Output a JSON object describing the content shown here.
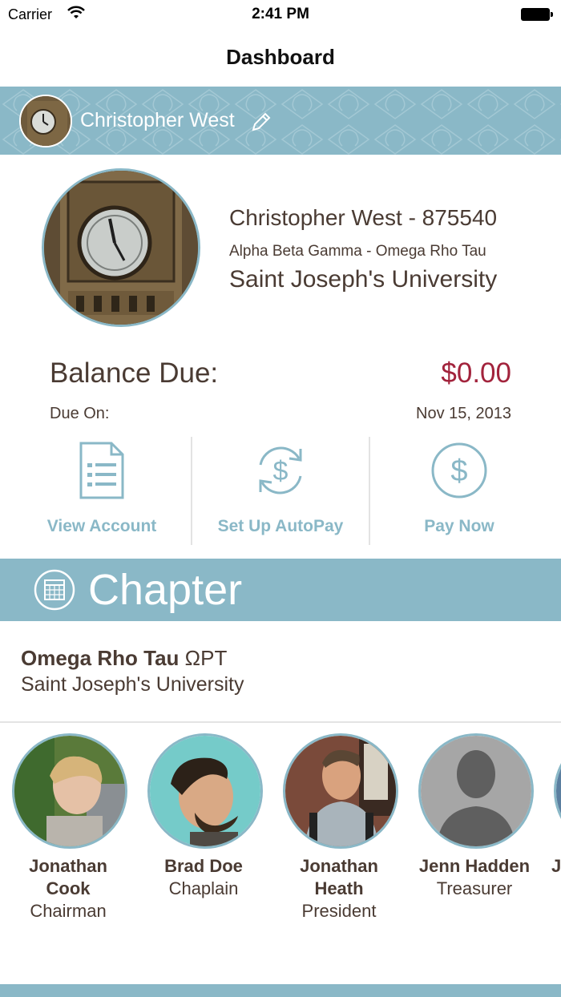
{
  "status": {
    "carrier": "Carrier",
    "time": "2:41 PM"
  },
  "nav": {
    "title": "Dashboard"
  },
  "strip": {
    "name": "Christopher West"
  },
  "profile": {
    "name_id": "Christopher West - 875540",
    "organization": "Alpha Beta Gamma - Omega Rho Tau",
    "school": "Saint Joseph's University"
  },
  "balance": {
    "label": "Balance Due:",
    "amount": "$0.00",
    "due_label": "Due On:",
    "due_date": "Nov 15, 2013"
  },
  "actions": [
    {
      "label": "View Account",
      "icon": "document-list-icon"
    },
    {
      "label": "Set Up AutoPay",
      "icon": "autopay-cycle-icon"
    },
    {
      "label": "Pay Now",
      "icon": "dollar-circle-icon"
    }
  ],
  "chapter": {
    "title": "Chapter",
    "name": "Omega Rho Tau",
    "letters": "ΩPT",
    "school": "Saint Joseph's University"
  },
  "officers": [
    {
      "name_line1": "Jonathan",
      "name_line2": "Cook",
      "role": "Chairman"
    },
    {
      "name_line1": "Brad Doe",
      "name_line2": "",
      "role": "Chaplain"
    },
    {
      "name_line1": "Jonathan",
      "name_line2": "Heath",
      "role": "President"
    },
    {
      "name_line1": "Jenn Hadden",
      "name_line2": "",
      "role": "Treasurer"
    },
    {
      "name_line1": "J",
      "name_line2": "",
      "role": ""
    }
  ],
  "colors": {
    "accent": "#8ab8c7",
    "balance": "#a2233c",
    "text": "#4a3b33"
  }
}
